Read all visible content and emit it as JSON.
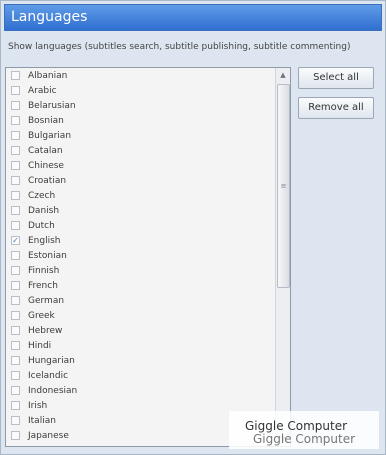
{
  "window": {
    "title": "Languages"
  },
  "description": "Show languages (subtitles search, subtitle publishing, subtitle commenting)",
  "buttons": {
    "select_all": "Select all",
    "remove_all": "Remove all"
  },
  "languages": [
    {
      "label": "Albanian",
      "checked": false
    },
    {
      "label": "Arabic",
      "checked": false
    },
    {
      "label": "Belarusian",
      "checked": false
    },
    {
      "label": "Bosnian",
      "checked": false
    },
    {
      "label": "Bulgarian",
      "checked": false
    },
    {
      "label": "Catalan",
      "checked": false
    },
    {
      "label": "Chinese",
      "checked": false
    },
    {
      "label": "Croatian",
      "checked": false
    },
    {
      "label": "Czech",
      "checked": false
    },
    {
      "label": "Danish",
      "checked": false
    },
    {
      "label": "Dutch",
      "checked": false
    },
    {
      "label": "English",
      "checked": true
    },
    {
      "label": "Estonian",
      "checked": false
    },
    {
      "label": "Finnish",
      "checked": false
    },
    {
      "label": "French",
      "checked": false
    },
    {
      "label": "German",
      "checked": false
    },
    {
      "label": "Greek",
      "checked": false
    },
    {
      "label": "Hebrew",
      "checked": false
    },
    {
      "label": "Hindi",
      "checked": false
    },
    {
      "label": "Hungarian",
      "checked": false
    },
    {
      "label": "Icelandic",
      "checked": false
    },
    {
      "label": "Indonesian",
      "checked": false
    },
    {
      "label": "Irish",
      "checked": false
    },
    {
      "label": "Italian",
      "checked": false
    },
    {
      "label": "Japanese",
      "checked": false
    }
  ],
  "icons": {
    "scroll_up": "scroll-up-arrow-icon",
    "scroll_down": "scroll-down-arrow-icon",
    "thumb_grip": "scroll-grip-icon",
    "check": "checkmark-icon"
  },
  "watermark": {
    "line1": "Giggle Computer",
    "line2": "Giggle Computer"
  },
  "colors": {
    "title_bar": "#3a78dc",
    "panel_bg": "#dde6f0"
  }
}
